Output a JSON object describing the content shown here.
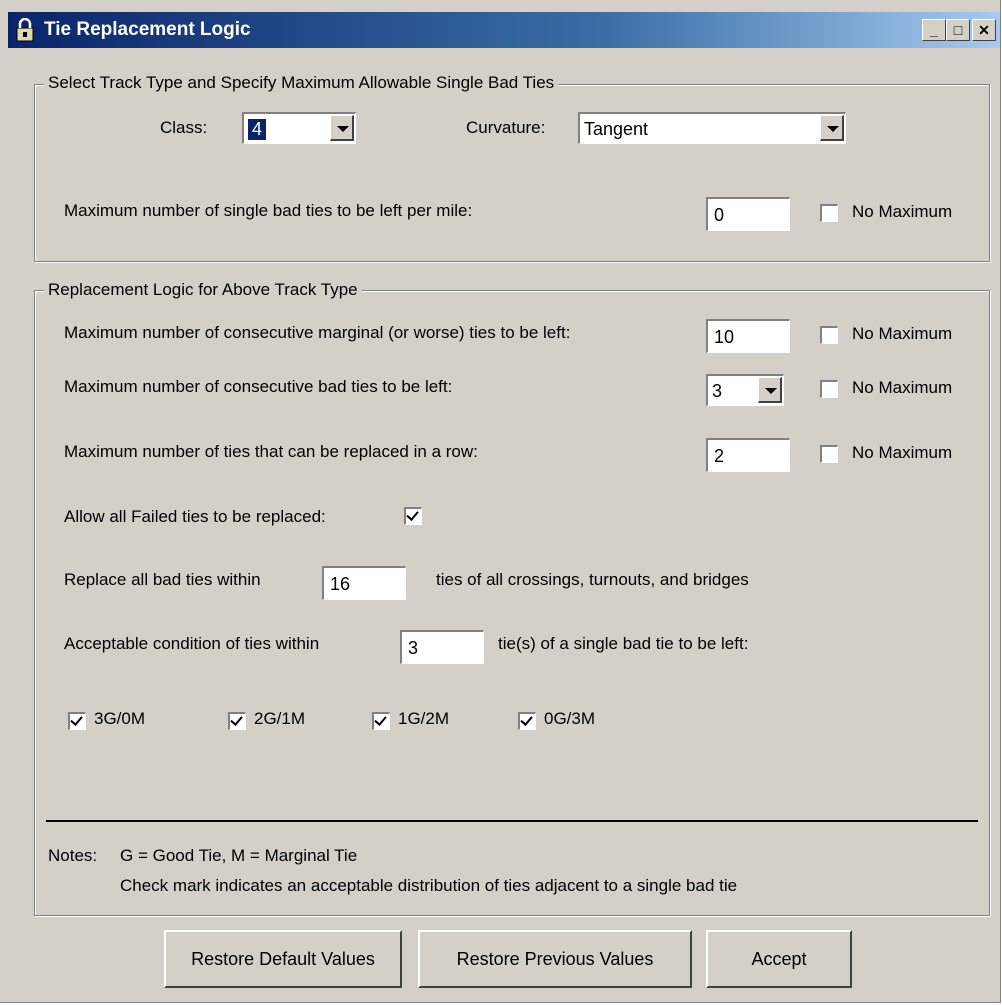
{
  "window": {
    "title": "Tie Replacement Logic",
    "controls": {
      "minimize": "_",
      "maximize": "□",
      "close": "✕"
    }
  },
  "track_type": {
    "group_title": "Select Track Type and Specify Maximum Allowable Single Bad Ties",
    "class_label": "Class:",
    "class_value": "4",
    "curvature_label": "Curvature:",
    "curvature_value": "Tangent",
    "max_single_label": "Maximum number of single bad ties to be left per mile:",
    "max_single_value": "0",
    "no_max_label": "No Maximum",
    "no_max_checked": false
  },
  "replacement_logic": {
    "group_title": "Replacement Logic for Above Track Type",
    "rows": [
      {
        "label": "Maximum number of consecutive marginal (or worse) ties to be left:",
        "value": "10",
        "no_max_label": "No Maximum",
        "no_max_checked": false
      },
      {
        "label": "Maximum number of consecutive bad ties to be left:",
        "value": "3",
        "no_max_label": "No Maximum",
        "no_max_checked": false
      },
      {
        "label": "Maximum number of ties that can be replaced in a row:",
        "value": "2",
        "no_max_label": "No Maximum",
        "no_max_checked": false
      }
    ],
    "allow_failed_label": "Allow all Failed ties to be replaced:",
    "allow_failed_checked": true,
    "replace_prefix": "Replace all bad ties within",
    "replace_value": "16",
    "replace_suffix": "ties of all crossings, turnouts, and bridges",
    "acceptable_prefix": "Acceptable condition of ties within",
    "acceptable_value": "3",
    "acceptable_suffix": "tie(s) of a single bad tie to be left:",
    "distributions": [
      {
        "label": "3G/0M",
        "checked": true
      },
      {
        "label": "2G/1M",
        "checked": true
      },
      {
        "label": "1G/2M",
        "checked": true
      },
      {
        "label": "0G/3M",
        "checked": true
      }
    ],
    "notes_label": "Notes:",
    "notes_line1": "G = Good Tie, M = Marginal Tie",
    "notes_line2": "Check mark indicates an acceptable distribution of ties adjacent to a single bad tie"
  },
  "buttons": {
    "restore_default": "Restore Default Values",
    "restore_previous": "Restore Previous Values",
    "accept": "Accept"
  }
}
